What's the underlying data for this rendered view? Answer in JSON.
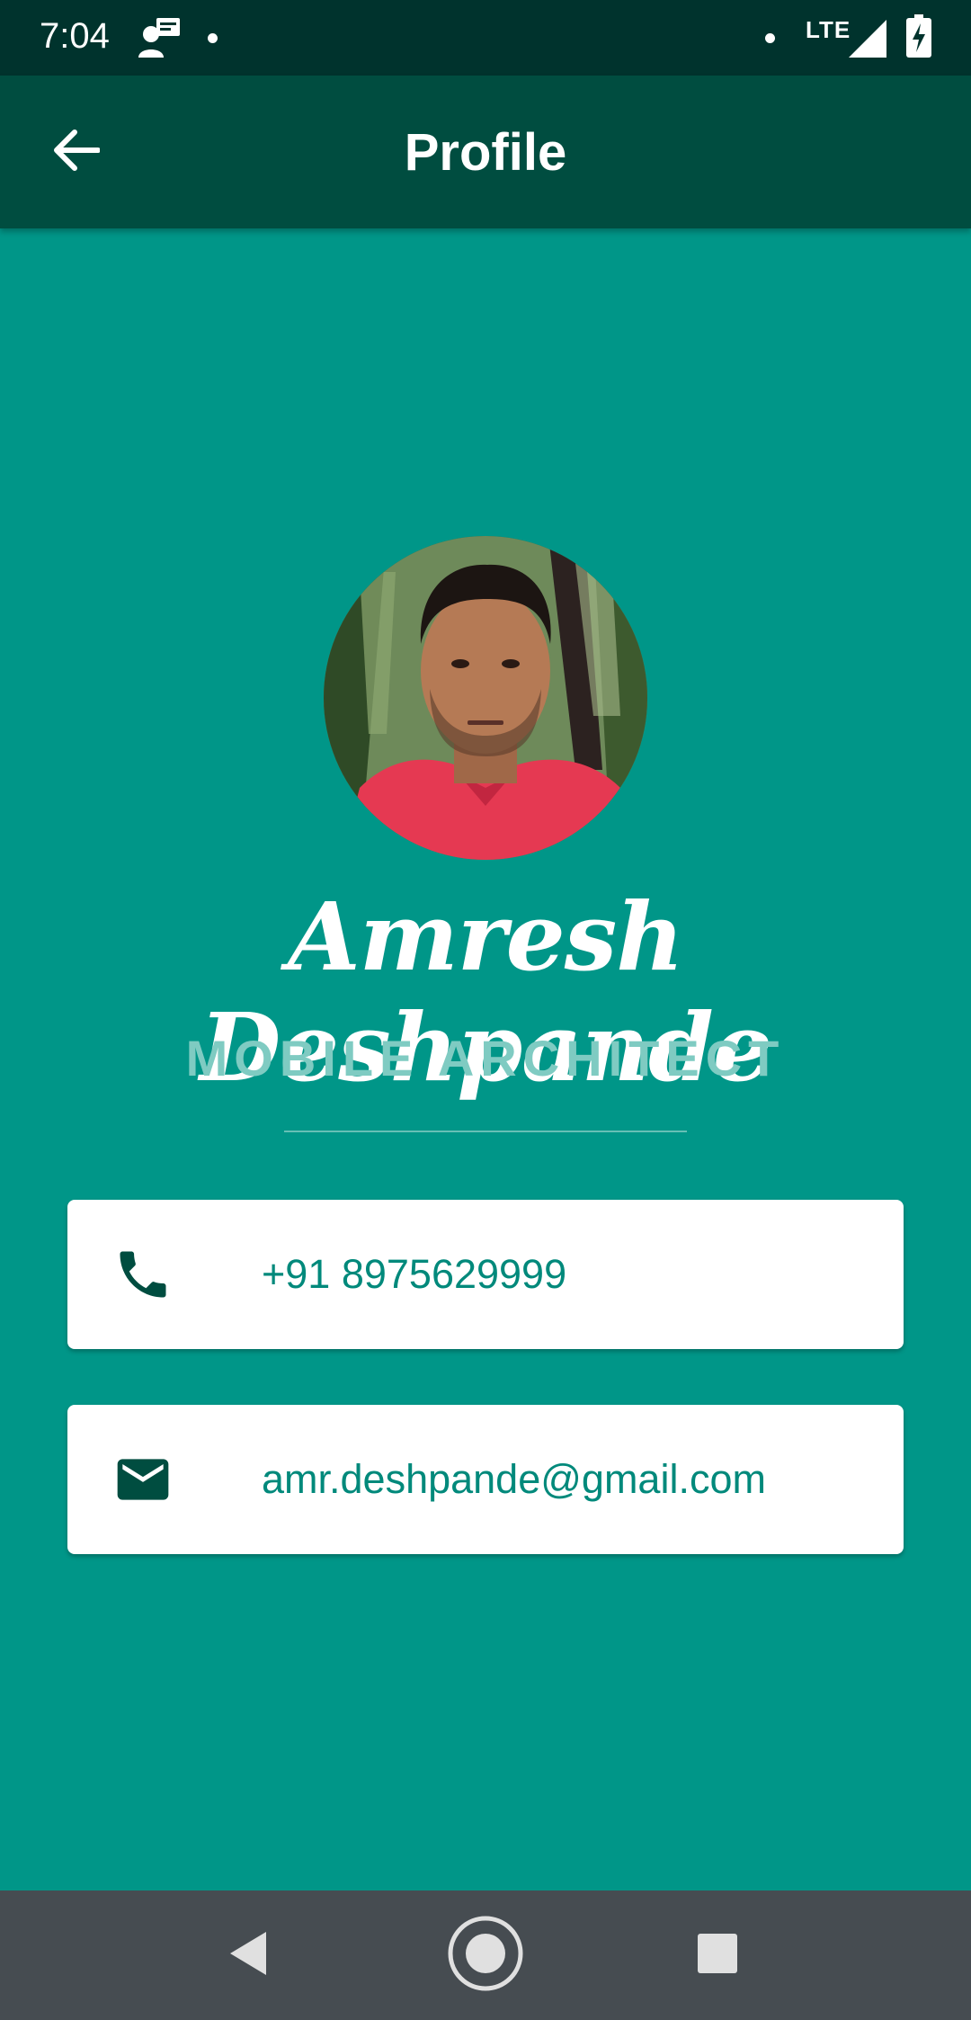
{
  "status_bar": {
    "time": "7:04",
    "network": "LTE",
    "icons": [
      "message-notification-icon",
      "dot-icon",
      "dot-icon",
      "signal-icon",
      "battery-charging-icon"
    ]
  },
  "app_bar": {
    "title": "Profile",
    "back_icon": "arrow-back-icon"
  },
  "profile": {
    "name": "Amresh Deshpande",
    "role": "MOBILE ARCHITECT",
    "avatar": "profile-photo"
  },
  "contacts": [
    {
      "icon": "phone-icon",
      "value": "+91 8975629999"
    },
    {
      "icon": "email-icon",
      "value": "amr.deshpande@gmail.com"
    }
  ],
  "nav_bar": {
    "buttons": [
      "back-triangle-icon",
      "home-circle-icon",
      "recents-square-icon"
    ]
  },
  "colors": {
    "background": "#009688",
    "app_bar": "#004d40",
    "status_bar": "#00332d",
    "accent_text": "#00897b",
    "icon_dark": "#004d40",
    "nav_bar": "#464c51"
  }
}
